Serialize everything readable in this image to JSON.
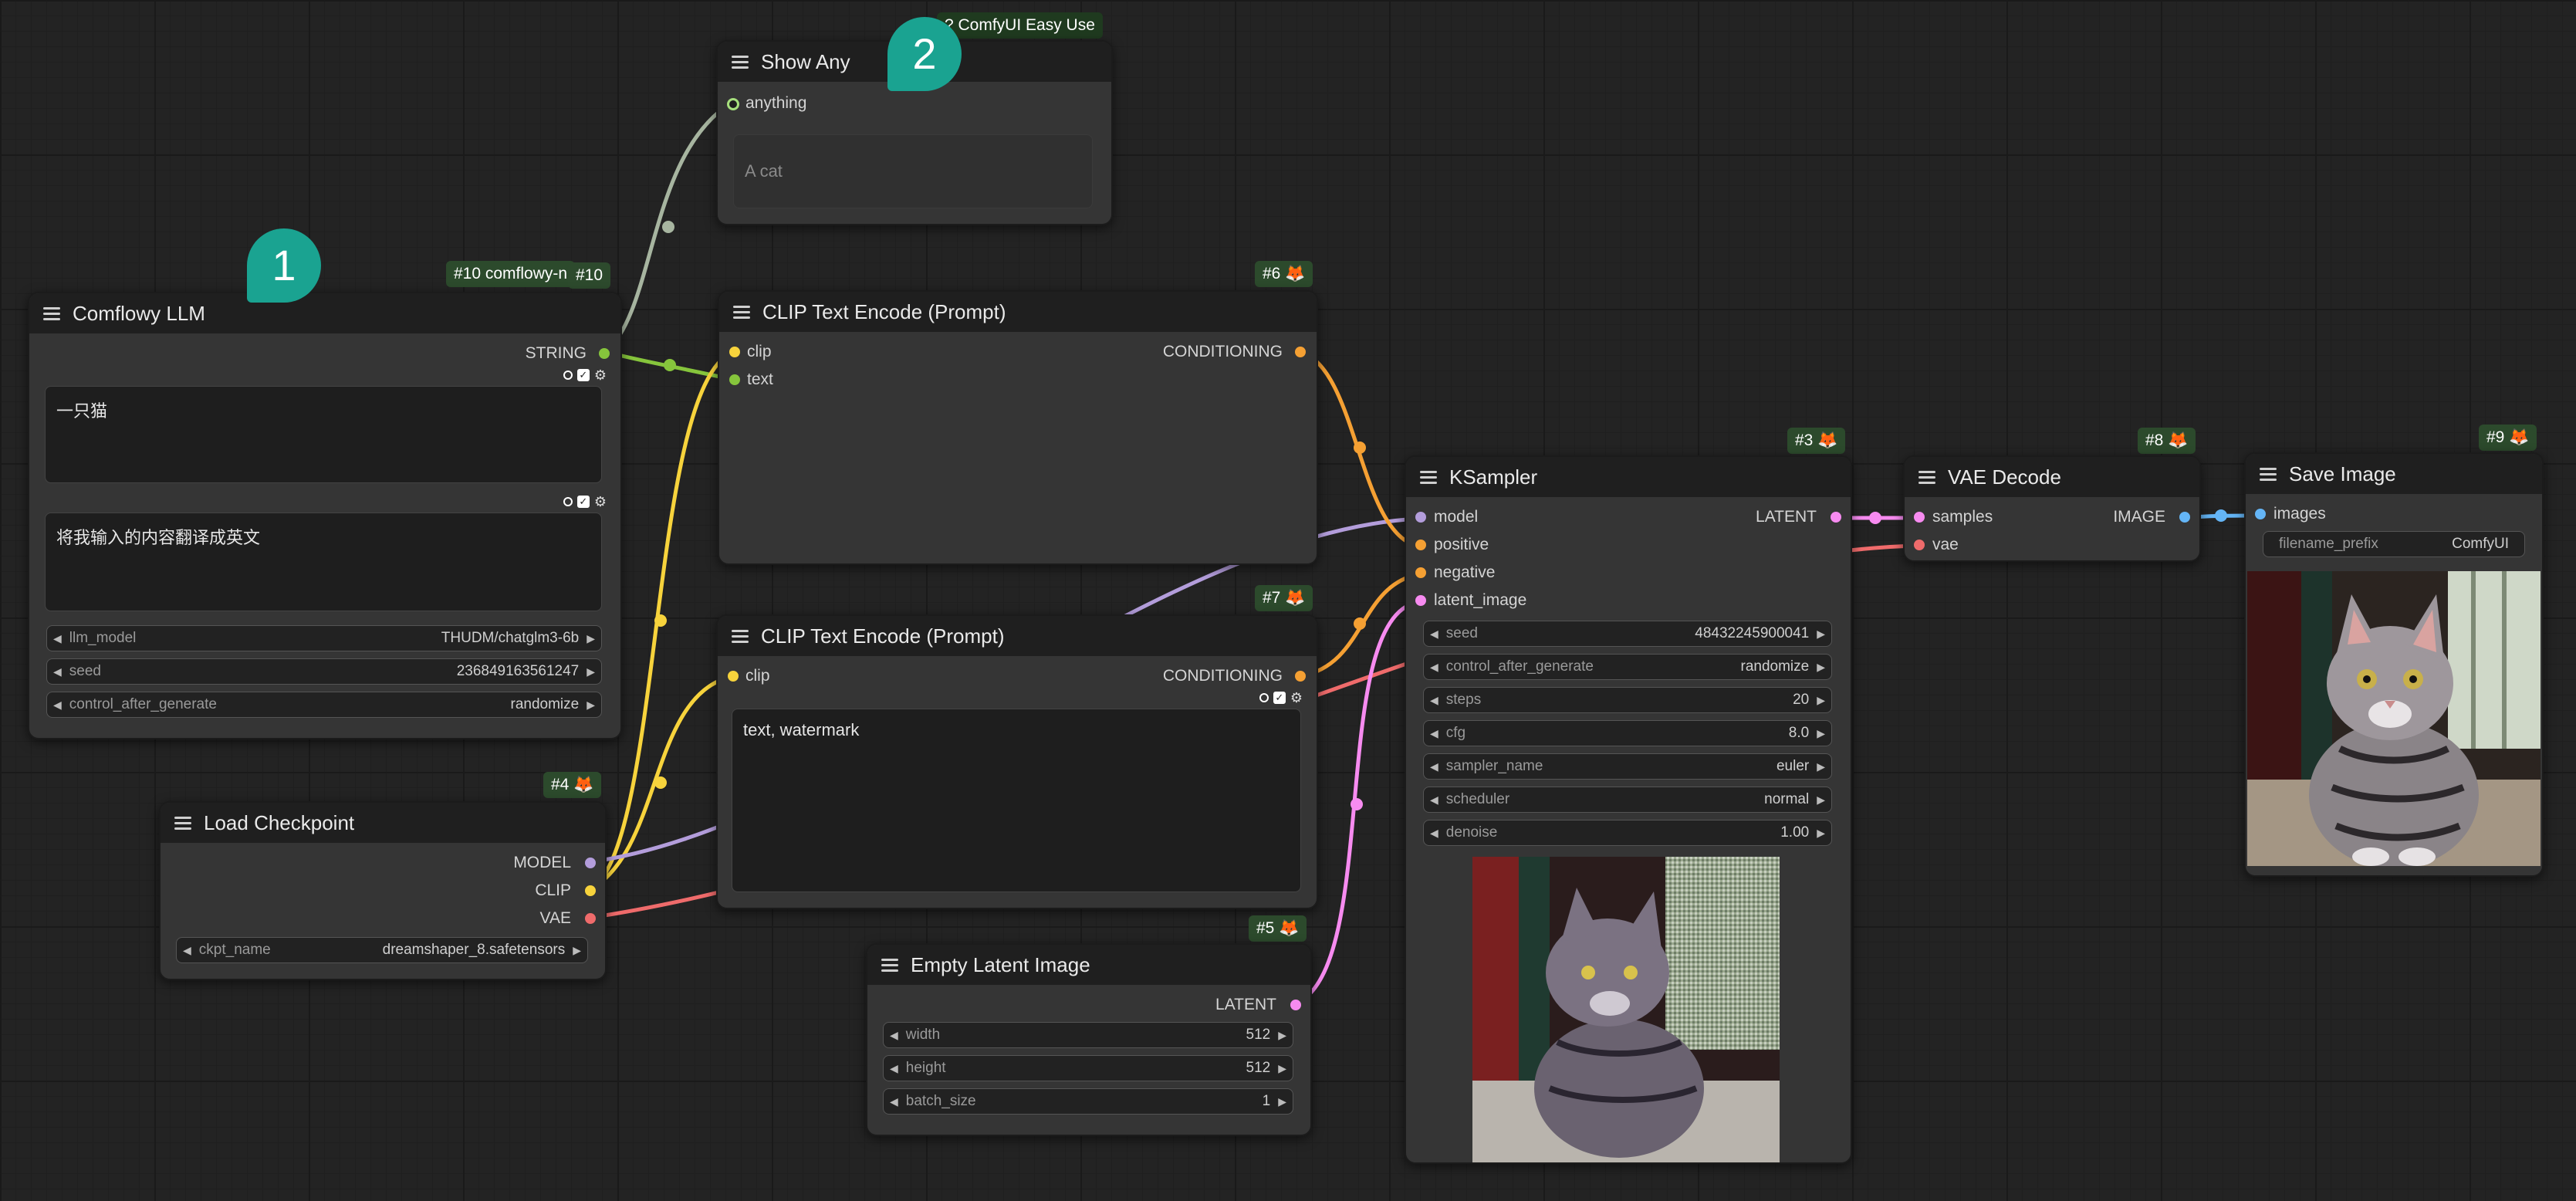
{
  "nodes": {
    "llm": {
      "title": "Comflowy LLM",
      "badge": "#10 comflowy-n",
      "id_tag": "#10",
      "output": "STRING",
      "prompt_text": "一只猫",
      "instruction_text": "将我输入的内容翻译成英文",
      "widgets": [
        {
          "name": "llm_model",
          "value": "THUDM/chatglm3-6b"
        },
        {
          "name": "seed",
          "value": "236849163561247"
        },
        {
          "name": "control_after_generate",
          "value": "randomize"
        }
      ]
    },
    "show": {
      "title": "Show Any",
      "badge": "? ComfyUI Easy Use",
      "input": "anything",
      "display_text": "A cat"
    },
    "clip1": {
      "title": "CLIP Text Encode (Prompt)",
      "badge": "#6",
      "inputs": [
        "clip",
        "text"
      ],
      "output": "CONDITIONING"
    },
    "clip2": {
      "title": "CLIP Text Encode (Prompt)",
      "badge": "#7",
      "input": "clip",
      "output": "CONDITIONING",
      "text": "text, watermark"
    },
    "checkpoint": {
      "title": "Load Checkpoint",
      "badge": "#4",
      "outputs": [
        "MODEL",
        "CLIP",
        "VAE"
      ],
      "widget": {
        "name": "ckpt_name",
        "value": "dreamshaper_8.safetensors"
      }
    },
    "latent": {
      "title": "Empty Latent Image",
      "badge": "#5",
      "output": "LATENT",
      "widgets": [
        {
          "name": "width",
          "value": "512"
        },
        {
          "name": "height",
          "value": "512"
        },
        {
          "name": "batch_size",
          "value": "1"
        }
      ]
    },
    "ksampler": {
      "title": "KSampler",
      "badge": "#3",
      "inputs": [
        "model",
        "positive",
        "negative",
        "latent_image"
      ],
      "output": "LATENT",
      "widgets": [
        {
          "name": "seed",
          "value": "48432245900041"
        },
        {
          "name": "control_after_generate",
          "value": "randomize"
        },
        {
          "name": "steps",
          "value": "20"
        },
        {
          "name": "cfg",
          "value": "8.0"
        },
        {
          "name": "sampler_name",
          "value": "euler"
        },
        {
          "name": "scheduler",
          "value": "normal"
        },
        {
          "name": "denoise",
          "value": "1.00"
        }
      ]
    },
    "vae": {
      "title": "VAE Decode",
      "badge": "#8",
      "inputs": [
        "samples",
        "vae"
      ],
      "output": "IMAGE"
    },
    "save": {
      "title": "Save Image",
      "badge": "#9",
      "input": "images",
      "widget": {
        "name": "filename_prefix",
        "value": "ComfyUI"
      }
    }
  },
  "bubbles": {
    "first": "1",
    "second": "2"
  },
  "colors": {
    "string": "#86c53c",
    "clip": "#f7d33c",
    "conditioning": "#f5a033",
    "model": "#b39ddb",
    "vae": "#ef6b6b",
    "latent": "#f78bf0",
    "image": "#64b5f6",
    "any": "#a7b5a0",
    "bubble": "#1aa391"
  }
}
